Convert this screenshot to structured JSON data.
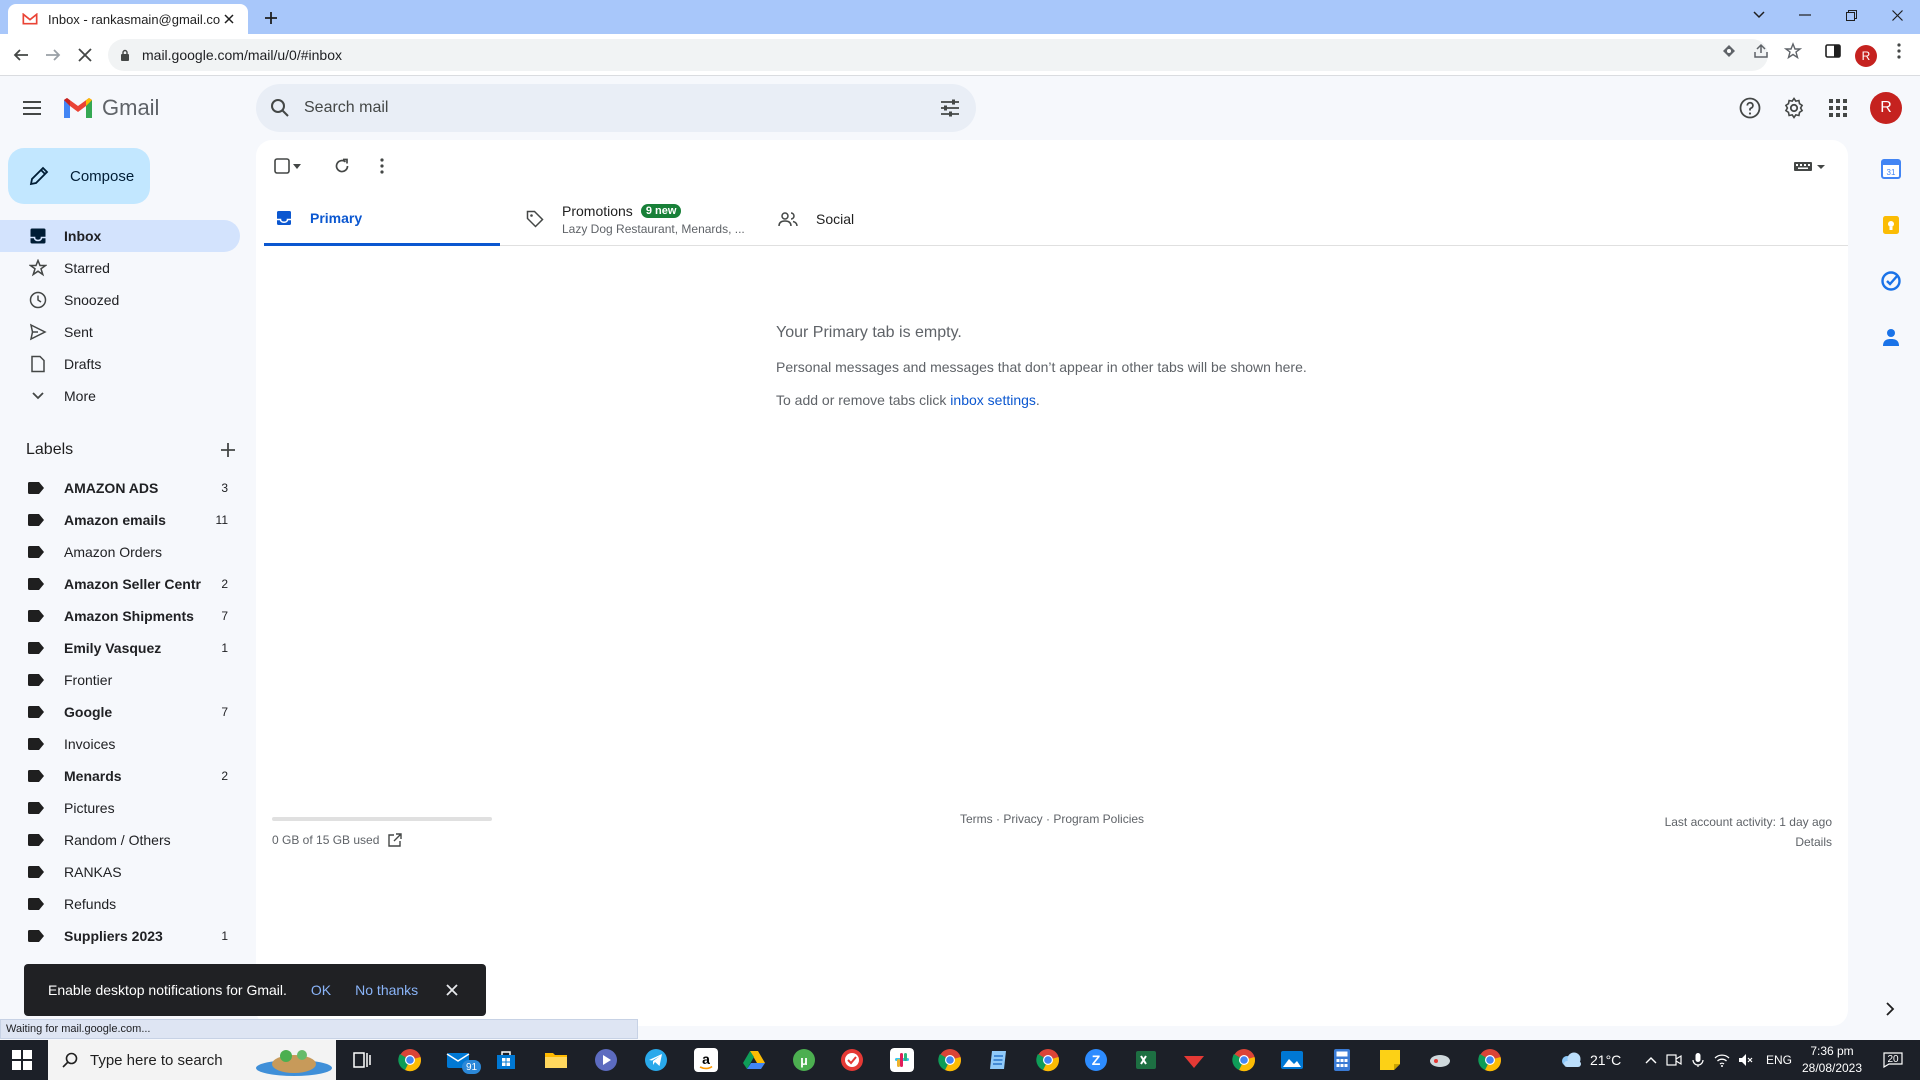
{
  "browser": {
    "tab_title": "Inbox - rankasmain@gmail.com",
    "url": "mail.google.com/mail/u/0/#inbox",
    "profile_initial": "R"
  },
  "header": {
    "app_name": "Gmail",
    "search_placeholder": "Search mail",
    "avatar_initial": "R"
  },
  "compose_label": "Compose",
  "nav": {
    "items": [
      {
        "label": "Inbox",
        "icon": "inbox-icon"
      },
      {
        "label": "Starred",
        "icon": "star-icon"
      },
      {
        "label": "Snoozed",
        "icon": "clock-icon"
      },
      {
        "label": "Sent",
        "icon": "send-icon"
      },
      {
        "label": "Drafts",
        "icon": "draft-icon"
      },
      {
        "label": "More",
        "icon": "chevron-down-icon"
      }
    ]
  },
  "labels": {
    "title": "Labels",
    "items": [
      {
        "label": "AMAZON ADS",
        "count": "3"
      },
      {
        "label": "Amazon emails",
        "count": "11"
      },
      {
        "label": "Amazon Orders",
        "count": ""
      },
      {
        "label": "Amazon Seller Centr",
        "count": "2"
      },
      {
        "label": "Amazon Shipments",
        "count": "7"
      },
      {
        "label": "Emily Vasquez",
        "count": "1"
      },
      {
        "label": "Frontier",
        "count": ""
      },
      {
        "label": "Google",
        "count": "7"
      },
      {
        "label": "Invoices",
        "count": ""
      },
      {
        "label": "Menards",
        "count": "2"
      },
      {
        "label": "Pictures",
        "count": ""
      },
      {
        "label": "Random / Others",
        "count": ""
      },
      {
        "label": "RANKAS",
        "count": ""
      },
      {
        "label": "Refunds",
        "count": ""
      },
      {
        "label": "Suppliers 2023",
        "count": "1"
      }
    ]
  },
  "inbox_tabs": {
    "primary": "Primary",
    "promotions": "Promotions",
    "promotions_badge": "9 new",
    "promotions_snippet": "Lazy Dog Restaurant, Menards, ...",
    "social": "Social"
  },
  "empty_state": {
    "heading": "Your Primary tab is empty.",
    "line1": "Personal messages and messages that don’t appear in other tabs will be shown here.",
    "line2_prefix": "To add or remove tabs click ",
    "line2_link": "inbox settings",
    "line2_suffix": "."
  },
  "footer": {
    "storage": "0 GB of 15 GB used",
    "links": "Terms · Privacy · Program Policies",
    "activity": "Last account activity: 1 day ago",
    "details": "Details"
  },
  "toast": {
    "message": "Enable desktop notifications for Gmail.",
    "ok": "OK",
    "no_thanks": "No thanks"
  },
  "statusbar": "Waiting for mail.google.com...",
  "taskbar": {
    "search_placeholder": "Type here to search",
    "weather": "21°C",
    "lang": "ENG",
    "time": "7:36 pm",
    "date": "28/08/2023",
    "notif_count": "20",
    "mail_badge": "91"
  },
  "colors": {
    "accent": "#0b57d0",
    "compose_bg": "#c2e7ff",
    "active_nav": "#d3e3fd",
    "badge_green": "#188038",
    "tabstrip": "#a8c7fa"
  }
}
